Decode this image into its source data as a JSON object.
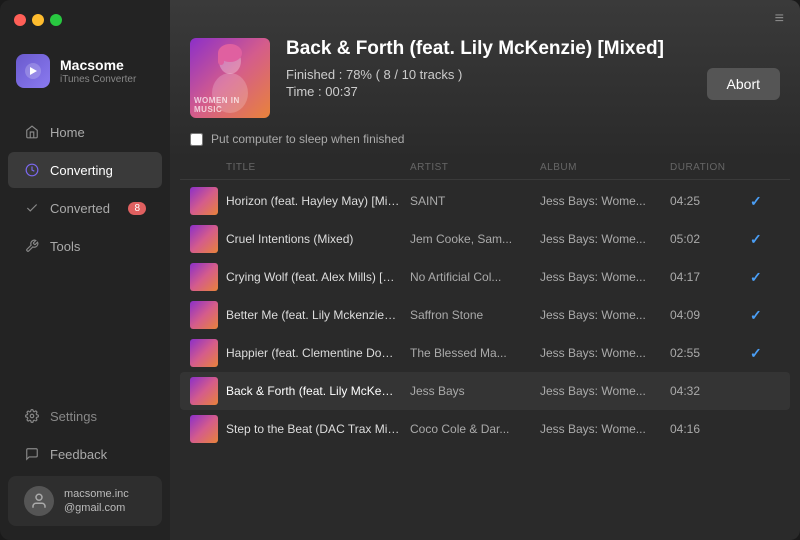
{
  "app": {
    "name": "Macsome",
    "subtitle": "iTunes Converter",
    "menu_icon": "≡"
  },
  "window_controls": {
    "red": "#ff5f57",
    "yellow": "#febc2e",
    "green": "#28c840"
  },
  "sidebar": {
    "nav_items": [
      {
        "id": "home",
        "label": "Home",
        "active": false,
        "badge": null
      },
      {
        "id": "converting",
        "label": "Converting",
        "active": true,
        "badge": null
      },
      {
        "id": "converted",
        "label": "Converted",
        "active": false,
        "badge": "8"
      },
      {
        "id": "tools",
        "label": "Tools",
        "active": false,
        "badge": null
      }
    ],
    "bottom_items": [
      {
        "id": "settings",
        "label": "Settings"
      },
      {
        "id": "feedback",
        "label": "Feedback"
      }
    ],
    "user": {
      "email_line1": "macsome.inc",
      "email_line2": "@gmail.com"
    }
  },
  "now_playing": {
    "title": "Back & Forth (feat. Lily McKenzie) [Mixed]",
    "progress_text": "Finished : 78% ( 8 / 10 tracks )",
    "time_text": "Time :  00:37",
    "abort_label": "Abort",
    "sleep_label": "Put computer to sleep when finished"
  },
  "track_list": {
    "headers": [
      "",
      "TITLE",
      "ARTIST",
      "ALBUM",
      "DURATION",
      ""
    ],
    "tracks": [
      {
        "title": "Horizon (feat. Hayley May) [Mixed]",
        "artist": "SAINT",
        "album": "Jess Bays: Wome...",
        "duration": "04:25",
        "done": true,
        "converting": false
      },
      {
        "title": "Cruel Intentions (Mixed)",
        "artist": "Jem Cooke, Sam...",
        "album": "Jess Bays: Wome...",
        "duration": "05:02",
        "done": true,
        "converting": false
      },
      {
        "title": "Crying Wolf (feat. Alex Mills) [Mixed]",
        "artist": "No Artificial Col...",
        "album": "Jess Bays: Wome...",
        "duration": "04:17",
        "done": true,
        "converting": false
      },
      {
        "title": "Better Me (feat. Lily Mckenzie) [Mixed]",
        "artist": "Saffron Stone",
        "album": "Jess Bays: Wome...",
        "duration": "04:09",
        "done": true,
        "converting": false
      },
      {
        "title": "Happier (feat. Clementine Douglas) [...",
        "artist": "The Blessed Ma...",
        "album": "Jess Bays: Wome...",
        "duration": "02:55",
        "done": true,
        "converting": false
      },
      {
        "title": "Back & Forth (feat. Lily McKenzie) [Mi...",
        "artist": "Jess Bays",
        "album": "Jess Bays: Wome...",
        "duration": "04:32",
        "done": false,
        "converting": true
      },
      {
        "title": "Step to the Beat (DAC Trax Mix) [Mixed]",
        "artist": "Coco Cole & Dar...",
        "album": "Jess Bays: Wome...",
        "duration": "04:16",
        "done": false,
        "converting": false
      }
    ]
  }
}
